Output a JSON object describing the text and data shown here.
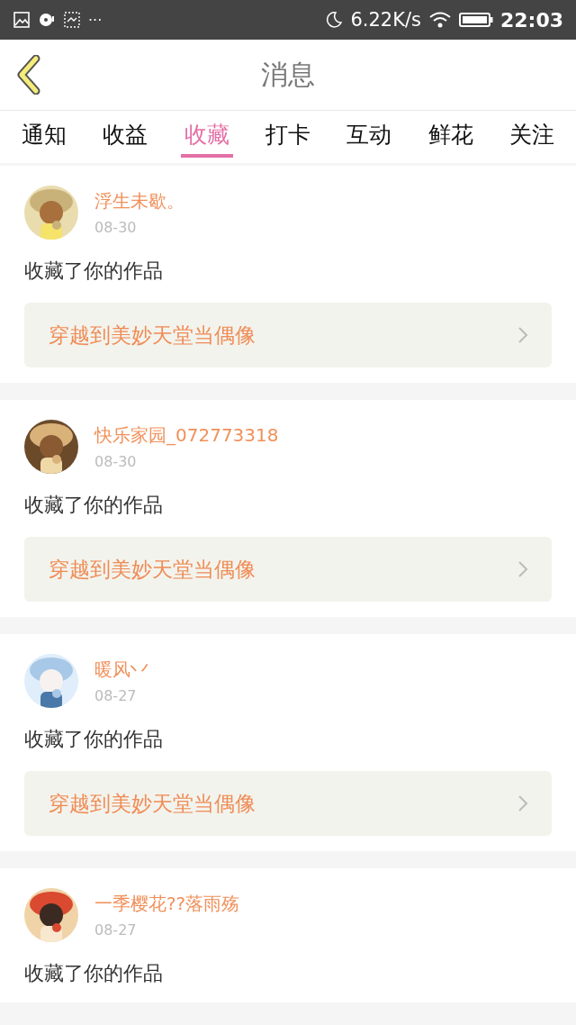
{
  "status_bar": {
    "more": "···",
    "speed": "6.22K/s",
    "time": "22:03"
  },
  "header": {
    "title": "消息"
  },
  "tabs": [
    {
      "label": "通知",
      "selected": false
    },
    {
      "label": "收益",
      "selected": false
    },
    {
      "label": "收藏",
      "selected": true
    },
    {
      "label": "打卡",
      "selected": false
    },
    {
      "label": "互动",
      "selected": false
    },
    {
      "label": "鲜花",
      "selected": false
    },
    {
      "label": "关注",
      "selected": false
    }
  ],
  "messages": [
    {
      "user": "浮生未歇。",
      "date": "08-30",
      "action": "收藏了你的作品",
      "work": "穿越到美妙天堂当偶像"
    },
    {
      "user": "快乐家园_072773318",
      "date": "08-30",
      "action": "收藏了你的作品",
      "work": "穿越到美妙天堂当偶像"
    },
    {
      "user": "暖风丷",
      "date": "08-27",
      "action": "收藏了你的作品",
      "work": "穿越到美妙天堂当偶像"
    },
    {
      "user": "一季樱花??落雨殇",
      "date": "08-27",
      "action": "收藏了你的作品"
    }
  ]
}
